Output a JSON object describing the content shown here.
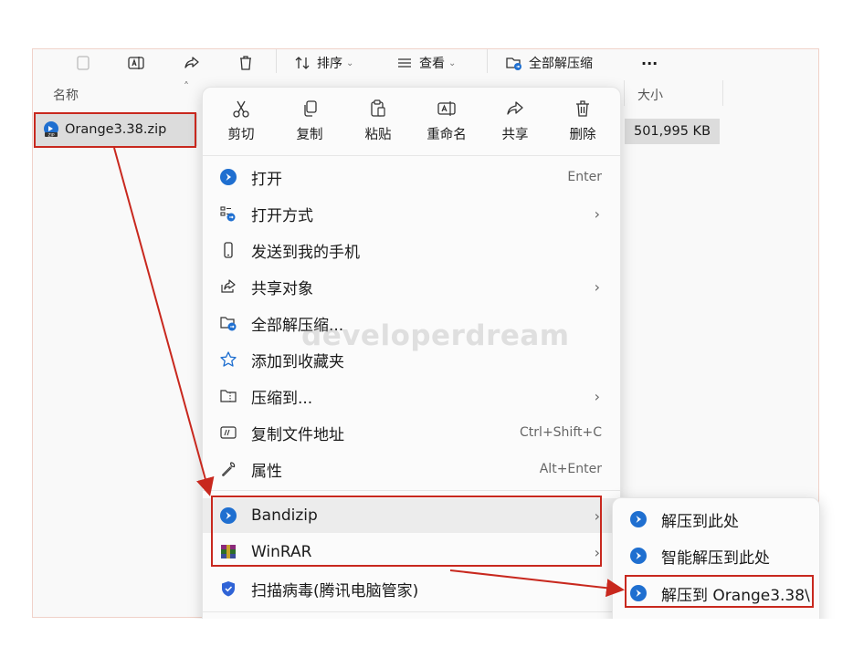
{
  "toolbar": {
    "sort_label": "排序",
    "view_label": "查看",
    "extract_all_label": "全部解压缩",
    "more_label": "···"
  },
  "columns": {
    "name": "名称",
    "size": "大小"
  },
  "file": {
    "name": "Orange3.38.zip",
    "size": "501,995 KB"
  },
  "quick_actions": [
    {
      "label": "剪切",
      "icon": "scissors-icon"
    },
    {
      "label": "复制",
      "icon": "copy-icon"
    },
    {
      "label": "粘贴",
      "icon": "paste-icon"
    },
    {
      "label": "重命名",
      "icon": "rename-icon"
    },
    {
      "label": "共享",
      "icon": "share-icon"
    },
    {
      "label": "删除",
      "icon": "trash-icon"
    }
  ],
  "menu_items": [
    {
      "label": "打开",
      "shortcut": "Enter",
      "icon": "bandizip-icon"
    },
    {
      "label": "打开方式",
      "submenu": true,
      "icon": "open-with-icon"
    },
    {
      "label": "发送到我的手机",
      "icon": "phone-icon"
    },
    {
      "label": "共享对象",
      "submenu": true,
      "icon": "share-icon"
    },
    {
      "label": "全部解压缩...",
      "icon": "folder-extract-icon"
    },
    {
      "label": "添加到收藏夹",
      "icon": "star-icon"
    },
    {
      "label": "压缩到...",
      "submenu": true,
      "icon": "archive-icon"
    },
    {
      "label": "复制文件地址",
      "shortcut": "Ctrl+Shift+C",
      "icon": "copy-path-icon"
    },
    {
      "label": "属性",
      "shortcut": "Alt+Enter",
      "icon": "wrench-icon"
    },
    {
      "label": "Bandizip",
      "submenu": true,
      "icon": "bandizip-icon"
    },
    {
      "label": "WinRAR",
      "submenu": true,
      "icon": "winrar-icon"
    },
    {
      "label": "扫描病毒(腾讯电脑管家)",
      "icon": "shield-icon"
    }
  ],
  "chevron": "›",
  "submenu_items": [
    {
      "label": "解压到此处",
      "icon": "bandizip-icon"
    },
    {
      "label": "智能解压到此处",
      "icon": "bandizip-icon"
    },
    {
      "label": "解压到 Orange3.38\\",
      "icon": "bandizip-icon"
    }
  ],
  "watermark": "developerdream",
  "colors": {
    "annotation_red": "#c8281e",
    "bandizip_blue": "#1f6fd0",
    "highlight": "#ececec"
  }
}
